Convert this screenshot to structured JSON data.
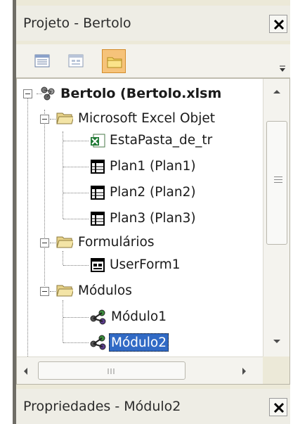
{
  "project_panel": {
    "title": "Projeto - Bertolo",
    "toolbar": [
      {
        "name": "view-code",
        "icon": "code-window-icon"
      },
      {
        "name": "view-object",
        "icon": "form-window-icon"
      },
      {
        "name": "toggle-folders",
        "icon": "folder-icon",
        "active": true
      }
    ],
    "tree": {
      "root": "Bertolo (Bertolo.xlsm",
      "folders": [
        {
          "label": "Microsoft Excel Objet",
          "items": [
            "EstaPasta_de_tr",
            "Plan1 (Plan1)",
            "Plan2 (Plan2)",
            "Plan3 (Plan3)"
          ]
        },
        {
          "label": "Formulários",
          "items": [
            "UserForm1"
          ]
        },
        {
          "label": "Módulos",
          "items": [
            "Módulo1",
            "Módulo2"
          ]
        }
      ],
      "selected": "Módulo2"
    }
  },
  "properties_panel": {
    "title": "Propriedades - Módulo2"
  },
  "colors": {
    "selection": "#316ac5",
    "active_tool": "#f6c37a",
    "panel_bg": "#ece9d8"
  }
}
